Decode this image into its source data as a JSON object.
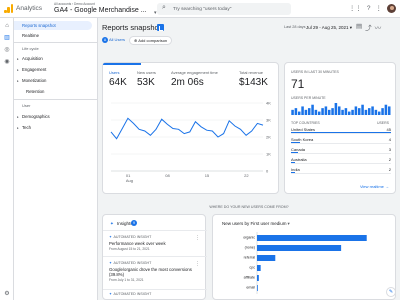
{
  "header": {
    "app_title": "Analytics",
    "breadcrumb": "All accounts › Demo Account",
    "property": "GA4 - Google Merchandise ...",
    "search_placeholder": "Try searching \"users today\"",
    "icons": [
      "apps-icon",
      "help-icon",
      "more-icon"
    ]
  },
  "rail": {
    "icons": [
      "home-icon",
      "reports-icon",
      "explore-icon",
      "advertising-icon",
      "configure-icon"
    ]
  },
  "nav": {
    "reports_snapshot": "Reports snapshot",
    "realtime": "Realtime",
    "life_cycle": "Life cycle",
    "acquisition": "Acquisition",
    "engagement": "Engagement",
    "monetization": "Monetization",
    "retention": "Retention",
    "user": "User",
    "demographics": "Demographics",
    "tech": "Tech"
  },
  "page": {
    "title": "Reports snapshot",
    "date_prefix": "Last 28 days",
    "date_range": "Jul 29 - Aug 25, 2021",
    "all_users": "All Users",
    "add_comparison": "Add comparison",
    "avatar_letter": "A"
  },
  "metrics": [
    {
      "label": "Users",
      "value": "64K"
    },
    {
      "label": "New users",
      "value": "53K"
    },
    {
      "label": "Average engagement time",
      "value": "2m 06s"
    },
    {
      "label": "Total revenue",
      "value": "$143K"
    }
  ],
  "chart_data": {
    "type": "line",
    "x_ticks": [
      "01\nAug",
      "08",
      "15",
      "22"
    ],
    "y_ticks": [
      "4K",
      "3K",
      "2K",
      "1K",
      "0"
    ],
    "ylim": [
      0,
      4000
    ],
    "series": [
      {
        "values": [
          2300,
          1900,
          2500,
          3100,
          2800,
          2450,
          2350,
          2100,
          2450,
          3050,
          2750,
          2500,
          2450,
          2200,
          2300,
          2900,
          2600,
          2400,
          2350,
          2000,
          2200,
          2950,
          2650,
          2450,
          2100,
          2350,
          2800,
          2700
        ]
      }
    ]
  },
  "realtime": {
    "title": "USERS IN LAST 30 MINUTES",
    "value": "71",
    "per_minute": "USERS PER MINUTE",
    "per_minute_values": [
      3,
      4,
      2,
      5,
      3,
      4,
      6,
      3,
      2,
      4,
      5,
      3,
      4,
      7,
      5,
      3,
      4,
      2,
      3,
      5,
      4,
      6,
      3,
      4,
      5,
      3,
      2,
      4,
      6,
      5
    ],
    "col_country": "TOP COUNTRIES",
    "col_users": "USERS",
    "countries": [
      {
        "name": "United States",
        "users": "45"
      },
      {
        "name": "South Korea",
        "users": "4"
      },
      {
        "name": "Canada",
        "users": "3"
      },
      {
        "name": "Australia",
        "users": "2"
      },
      {
        "name": "India",
        "users": "2"
      }
    ],
    "link": "View realtime"
  },
  "where_heading": "WHERE DO YOUR NEW USERS COME FROM?",
  "insights": {
    "title": "Insights",
    "count": "9",
    "items": [
      {
        "tag": "AUTOMATED INSIGHT",
        "title": "Performance week over week",
        "date": "From August 15 to 21, 2021"
      },
      {
        "tag": "AUTOMATED INSIGHT",
        "title": "Google/organic drove the most conversions (39.8%)",
        "date": "From July 1 to 31, 2021"
      },
      {
        "tag": "AUTOMATED INSIGHT",
        "title": "",
        "date": ""
      }
    ]
  },
  "new_users": {
    "dropdown": "New users by First user medium",
    "bar_chart": {
      "type": "bar",
      "categories": [
        "organic",
        "(none)",
        "referral",
        "cpc",
        "affiliate",
        "email"
      ],
      "values": [
        30000,
        23000,
        5000,
        1000,
        500,
        200
      ]
    }
  },
  "colors": {
    "accent": "#1a73e8",
    "selected_bg": "#e8f0fe",
    "logo": "#f9ab00"
  }
}
